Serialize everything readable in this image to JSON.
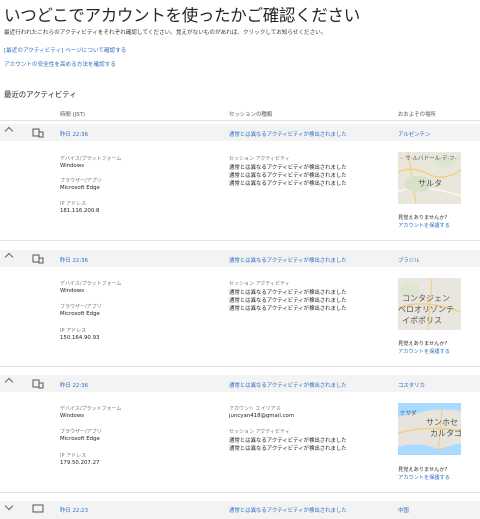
{
  "header": {
    "title": "いつどこでアカウントを使ったかご確認ください",
    "intro": "最近行われたこれらのアクティビティをそれぞれ確認してください。覚えがないものがあれば、クリックしてお知らせください。"
  },
  "links": {
    "recent_activity_page": "[最近のアクティビティ] ページについて確認する",
    "security_tips": "アカウントの安全性を高める方法を確認する"
  },
  "recent": {
    "heading": "最近のアクティビティ",
    "columns": {
      "time": "時間 (JST)",
      "session": "セッションの種類",
      "location": "おおよその場所"
    }
  },
  "labels": {
    "device": "デバイス/プラットフォーム",
    "browser": "ブラウザー/アプリ",
    "ip": "IP アドレス",
    "session_activity": "セッション アクティビティ",
    "alias": "アカウント エイリアス",
    "not_recognized": "見覚えありませんか?",
    "protect": "アカウントを保護する"
  },
  "activities": [
    {
      "time": "昨日 22:36",
      "session": "通常とは異なるアクティビティが検出されました",
      "location": "アルゼンチン",
      "device": "Windows",
      "browser": "Microsoft Edge",
      "ip": "181.116.200.8",
      "activity_lines": [
        "通常とは異なるアクティビティが検出されました",
        "通常とは異なるアクティビティが検出されました",
        "通常とは異なるアクティビティが検出されました"
      ],
      "map_labels": [
        "サルタ"
      ]
    },
    {
      "time": "昨日 22:36",
      "session": "通常とは異なるアクティビティが検出されました",
      "location": "ブラジル",
      "device": "Windows",
      "browser": "Microsoft Edge",
      "ip": "150.164.90.93",
      "activity_lines": [
        "通常とは異なるアクティビティが検出されました",
        "通常とは異なるアクティビティが検出されました",
        "通常とは異なるアクティビティが検出されました"
      ],
      "map_labels": [
        "コンタジェン",
        "ベロオリゾンテ",
        "イポポリス"
      ]
    },
    {
      "time": "昨日 22:36",
      "session": "通常とは異なるアクティビティが検出されました",
      "location": "コスタリカ",
      "device": "Windows",
      "browser": "Microsoft Edge",
      "ip": "179.50.207.27",
      "alias": "juncyan418@gmail.com",
      "activity_lines": [
        "通常とは異なるアクティビティが検出されました",
        "通常とは異なるアクティビティが検出されました"
      ],
      "map_labels": [
        "サンホセ",
        "カルタゴ"
      ]
    },
    {
      "time": "昨日 22:23",
      "session": "通常とは異なるアクティビティが検出されました",
      "location": "中国"
    }
  ]
}
